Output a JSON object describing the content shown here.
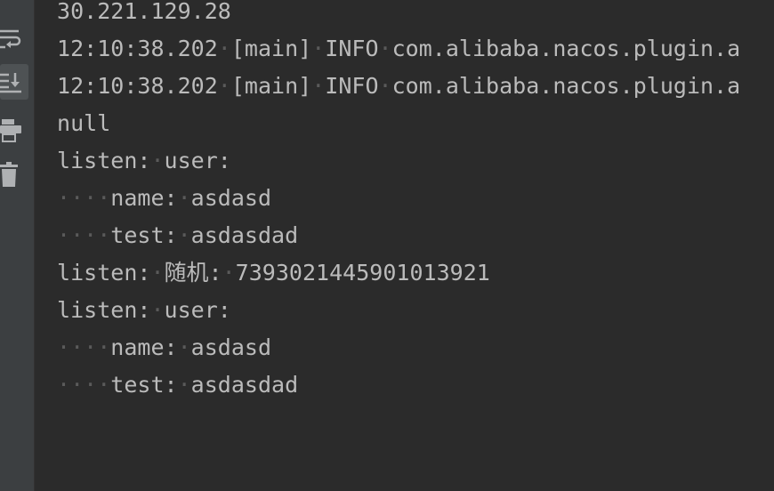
{
  "toolbar": {
    "buttons": [
      {
        "icon": "soft-wrap-icon",
        "active": false
      },
      {
        "icon": "scroll-to-end-icon",
        "active": true
      },
      {
        "icon": "print-icon",
        "active": false
      },
      {
        "icon": "trash-icon",
        "active": false
      }
    ]
  },
  "console": {
    "lines": [
      "30.221.129.28",
      "12:10:38.202 [main] INFO com.alibaba.nacos.plugin.a",
      "12:10:38.202 [main] INFO com.alibaba.nacos.plugin.a",
      "null",
      "listen: user:",
      "    name: asdasd",
      "    test: asdasdad",
      "listen: 随机: 7393021445901013921",
      "listen: user:",
      "    name: asdasd",
      "    test: asdasdad"
    ]
  },
  "colors": {
    "background": "#2b2b2b",
    "toolbar": "#3c3f41",
    "text": "#bbbbbb",
    "whitespace_dot": "#5a5a5a",
    "icon": "#afb1b3"
  }
}
